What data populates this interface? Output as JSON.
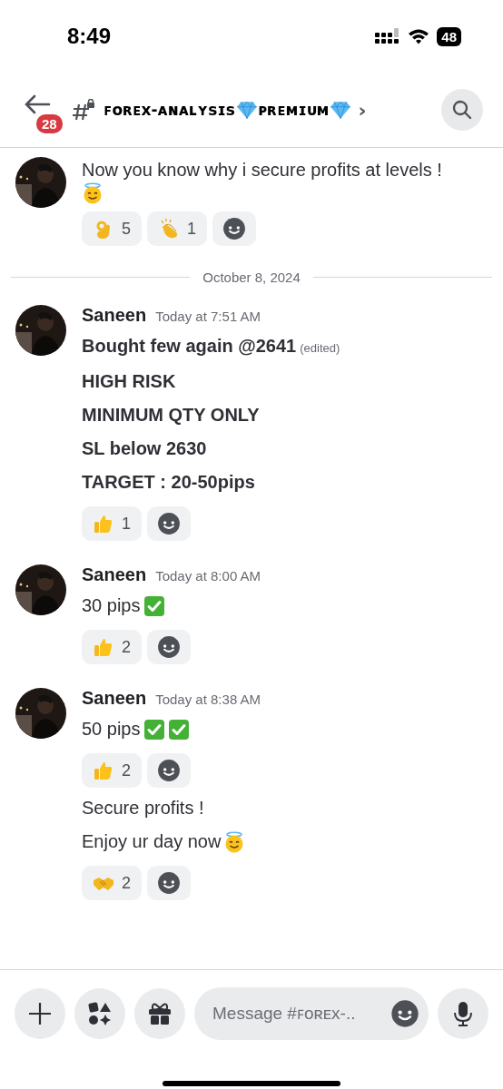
{
  "status_bar": {
    "time": "8:49",
    "battery": "48"
  },
  "header": {
    "unread_badge": "28",
    "channel_name": [
      {
        "kind": "text",
        "text": "ꜰᴏʀᴇx-ᴀɴᴀʟʏsɪs"
      },
      {
        "kind": "diamond"
      },
      {
        "kind": "text",
        "text": "ᴘʀᴇᴍɪᴜᴍ"
      },
      {
        "kind": "diamond"
      }
    ],
    "chevron": "›"
  },
  "messages": [
    {
      "blocks": [
        {
          "kind": "text",
          "lines": [
            {
              "text": "Now you know why i secure profits at levels !",
              "bold": false
            },
            {
              "icons": [
                {
                  "kind": "halo-smile"
                }
              ]
            }
          ]
        },
        {
          "kind": "reactions",
          "items": [
            {
              "kind": "ok-hand",
              "count": "5"
            },
            {
              "kind": "clap",
              "count": "1"
            }
          ]
        }
      ]
    },
    {
      "date": "October 8, 2024"
    },
    {
      "author": "Saneen",
      "time": "Today at 7:51 AM",
      "blocks": [
        {
          "kind": "text",
          "lines": [
            {
              "text": "Bought few again @2641",
              "bold": true,
              "edited": "(edited)"
            },
            {
              "text": "HIGH RISK",
              "bold": true
            },
            {
              "text": "MINIMUM QTY ONLY",
              "bold": true
            },
            {
              "text": "SL below 2630",
              "bold": true
            },
            {
              "text": "TARGET : 20-50pips",
              "bold": true
            }
          ]
        },
        {
          "kind": "reactions",
          "items": [
            {
              "kind": "thumbs-up",
              "count": "1"
            }
          ]
        }
      ]
    },
    {
      "author": "Saneen",
      "time": "Today at 8:00 AM",
      "blocks": [
        {
          "kind": "text",
          "lines": [
            {
              "text": "30 pips",
              "bold": false,
              "icons": [
                {
                  "kind": "check"
                }
              ]
            }
          ]
        },
        {
          "kind": "reactions",
          "items": [
            {
              "kind": "thumbs-up",
              "count": "2"
            }
          ]
        }
      ]
    },
    {
      "author": "Saneen",
      "time": "Today at 8:38 AM",
      "blocks": [
        {
          "kind": "text",
          "lines": [
            {
              "text": "50 pips",
              "bold": false,
              "icons": [
                {
                  "kind": "check"
                },
                {
                  "kind": "check"
                }
              ]
            }
          ]
        },
        {
          "kind": "reactions",
          "items": [
            {
              "kind": "thumbs-up",
              "count": "2"
            }
          ]
        },
        {
          "kind": "text",
          "lines": [
            {
              "text": "Secure profits !",
              "bold": false
            },
            {
              "text": "Enjoy ur day now",
              "bold": false,
              "icons": [
                {
                  "kind": "halo-smile"
                }
              ]
            }
          ]
        },
        {
          "kind": "reactions",
          "items": [
            {
              "kind": "handshake",
              "count": "2"
            }
          ]
        }
      ]
    }
  ],
  "composer": {
    "placeholder": "Message #ꜰᴏʀᴇx-.."
  }
}
